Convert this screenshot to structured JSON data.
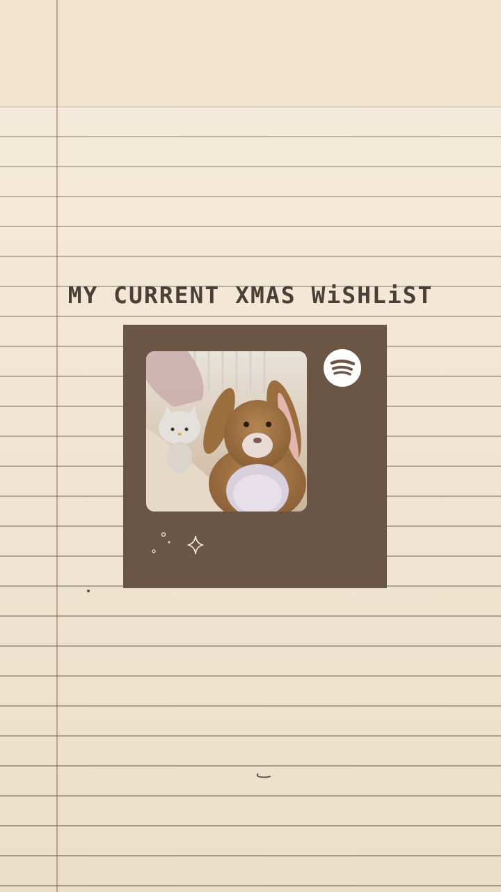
{
  "page": {
    "title": "MY CURRENT XMAS WiSHLiST"
  },
  "card": {
    "background_color": "#6b5646",
    "cover_image": "plush-toys-photo",
    "logo_icon": "spotify-icon",
    "decoration_icon": "sparkle-icon"
  },
  "paper": {
    "background_color": "#f3e6cf",
    "rule_color": "#6e645a",
    "margin_line_color": "#966e5f"
  }
}
